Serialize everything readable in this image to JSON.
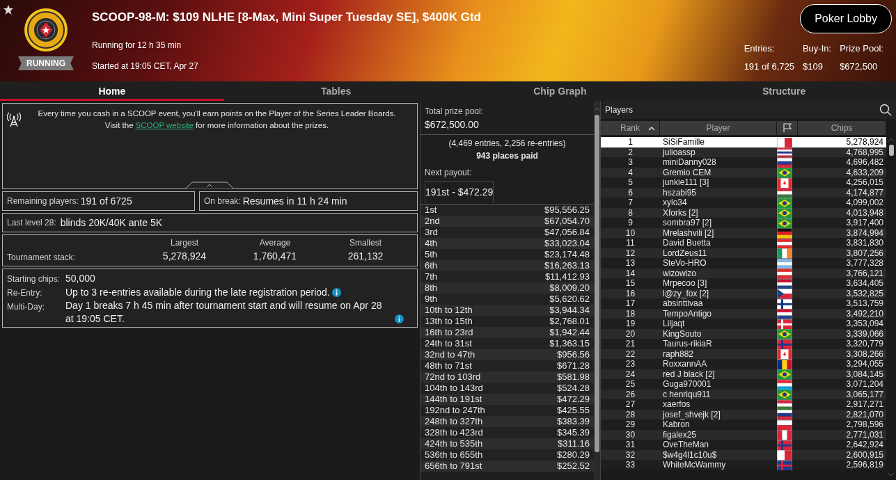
{
  "header": {
    "status": "RUNNING",
    "title": "SCOOP-98-M: $109 NLHE [8-Max, Mini Super Tuesday SE], $400K Gtd",
    "running_for": "Running for 12 h 35 min",
    "started": "Started at 19:05 CET, Apr 27",
    "button": "Poker Lobby",
    "stats": [
      {
        "label": "Entries:",
        "value": "191 of 6,725"
      },
      {
        "label": "Buy-In:",
        "value": "$109"
      },
      {
        "label": "Prize Pool:",
        "value": "$672,500"
      }
    ]
  },
  "tabs": [
    {
      "label": "Home",
      "selected": true
    },
    {
      "label": "Tables",
      "selected": false
    },
    {
      "label": "Chip Graph",
      "selected": false
    },
    {
      "label": "Structure",
      "selected": false
    }
  ],
  "notice": {
    "line1": "Every time you cash in a SCOOP event, you'll earn points on the Player of the Series Leader Boards.",
    "before_link": "Visit the",
    "link": "SCOOP website",
    "after_link": "for more information about the prizes."
  },
  "remaining": {
    "label": "Remaining players:",
    "value": "191 of 6725"
  },
  "on_break": {
    "label": "On break:",
    "value": "Resumes in 11 h 24 min"
  },
  "last_level": {
    "label": "Last level 28:",
    "value": "blinds 20K/40K ante 5K"
  },
  "stack": {
    "label": "Tournament stack:",
    "columns": [
      {
        "label": "Largest",
        "value": "5,278,924"
      },
      {
        "label": "Average",
        "value": "1,760,471"
      },
      {
        "label": "Smallest",
        "value": "261,132"
      }
    ]
  },
  "details": [
    {
      "label": "Starting chips:",
      "value": "50,000",
      "info": false
    },
    {
      "label": "Re-Entry:",
      "value": "Up to 3 re-entries available during the late registration period.",
      "info": true
    },
    {
      "label": "Multi-Day:",
      "value": "Day 1 breaks 7 h 45 min after tournament start and will resume on Apr 28 at 19:05 CET.",
      "info": true
    }
  ],
  "prize": {
    "label": "Total prize pool:",
    "value": "$672,500.00",
    "entries": "(4,469 entries, 2,256 re-entries)",
    "places": "943 places paid",
    "next_label": "Next payout:",
    "next_value": "191st - $472.29"
  },
  "payouts": [
    {
      "place": "1st",
      "amount": "$95,556.25"
    },
    {
      "place": "2nd",
      "amount": "$67,054.70"
    },
    {
      "place": "3rd",
      "amount": "$47,056.84"
    },
    {
      "place": "4th",
      "amount": "$33,023.04"
    },
    {
      "place": "5th",
      "amount": "$23,174.48"
    },
    {
      "place": "6th",
      "amount": "$16,263.13"
    },
    {
      "place": "7th",
      "amount": "$11,412.93"
    },
    {
      "place": "8th",
      "amount": "$8,009.20"
    },
    {
      "place": "9th",
      "amount": "$5,620.62"
    },
    {
      "place": "10th to 12th",
      "amount": "$3,944.34"
    },
    {
      "place": "13th to 15th",
      "amount": "$2,768.01"
    },
    {
      "place": "16th to 23rd",
      "amount": "$1,942.44"
    },
    {
      "place": "24th to 31st",
      "amount": "$1,363.15"
    },
    {
      "place": "32nd to 47th",
      "amount": "$956.56"
    },
    {
      "place": "48th to 71st",
      "amount": "$671.28"
    },
    {
      "place": "72nd to 103rd",
      "amount": "$581.98"
    },
    {
      "place": "104th to 143rd",
      "amount": "$524.28"
    },
    {
      "place": "144th to 191st",
      "amount": "$472.29"
    },
    {
      "place": "192nd to 247th",
      "amount": "$425.55"
    },
    {
      "place": "248th to 327th",
      "amount": "$383.39"
    },
    {
      "place": "328th to 423rd",
      "amount": "$345.39"
    },
    {
      "place": "424th to 535th",
      "amount": "$311.16"
    },
    {
      "place": "536th to 655th",
      "amount": "$280.29"
    },
    {
      "place": "656th to 791st",
      "amount": "$252.52"
    }
  ],
  "players": {
    "title": "Players",
    "columns": [
      "Rank",
      "Player",
      "Chips"
    ],
    "rows": [
      {
        "rank": "1",
        "name": "SiSiFamille",
        "chips": "5,278,924",
        "selected": true
      },
      {
        "rank": "2",
        "name": "julioassp",
        "chips": "4,768,995",
        "selected": false
      },
      {
        "rank": "3",
        "name": "miniDanny028",
        "chips": "4,696,482",
        "selected": false
      },
      {
        "rank": "4",
        "name": "Gremio CEM",
        "chips": "4,633,209",
        "selected": false
      },
      {
        "rank": "5",
        "name": "junkie111 [3]",
        "chips": "4,256,015",
        "selected": false
      },
      {
        "rank": "6",
        "name": "hszabi95",
        "chips": "4,174,877",
        "selected": false
      },
      {
        "rank": "7",
        "name": "xylo34",
        "chips": "4,099,002",
        "selected": false
      },
      {
        "rank": "8",
        "name": "Xforks [2]",
        "chips": "4,013,948",
        "selected": false
      },
      {
        "rank": "9",
        "name": "sombra97 [2]",
        "chips": "3,917,400",
        "selected": false
      },
      {
        "rank": "10",
        "name": "Mrelashvili [2]",
        "chips": "3,874,994",
        "selected": false
      },
      {
        "rank": "11",
        "name": "David Buetta",
        "chips": "3,831,830",
        "selected": false
      },
      {
        "rank": "12",
        "name": "LordZeus11",
        "chips": "3,807,256",
        "selected": false
      },
      {
        "rank": "13",
        "name": "SteVo-HRO",
        "chips": "3,777,328",
        "selected": false
      },
      {
        "rank": "14",
        "name": "wizowizo",
        "chips": "3,766,121",
        "selected": false
      },
      {
        "rank": "15",
        "name": "Mrpecoo [3]",
        "chips": "3,634,405",
        "selected": false
      },
      {
        "rank": "16",
        "name": "l@zy_fox [2]",
        "chips": "3,532,825",
        "selected": false
      },
      {
        "rank": "17",
        "name": "absinttivaa",
        "chips": "3,513,759",
        "selected": false
      },
      {
        "rank": "18",
        "name": "TempoAntigo",
        "chips": "3,492,210",
        "selected": false
      },
      {
        "rank": "19",
        "name": "Liljaqt",
        "chips": "3,353,094",
        "selected": false
      },
      {
        "rank": "20",
        "name": "KingSouto",
        "chips": "3,339,066",
        "selected": false
      },
      {
        "rank": "21",
        "name": "Taurus-rikiaR",
        "chips": "3,320,779",
        "selected": false
      },
      {
        "rank": "22",
        "name": "raph882",
        "chips": "3,308,266",
        "selected": false
      },
      {
        "rank": "23",
        "name": "RoxxannAA",
        "chips": "3,294,055",
        "selected": false
      },
      {
        "rank": "24",
        "name": "red J black [2]",
        "chips": "3,084,145",
        "selected": false
      },
      {
        "rank": "25",
        "name": "Guga970001",
        "chips": "3,071,204",
        "selected": false
      },
      {
        "rank": "26",
        "name": "c henriqu911",
        "chips": "3,065,177",
        "selected": false
      },
      {
        "rank": "27",
        "name": "xaerfos",
        "chips": "2,917,271",
        "selected": false
      },
      {
        "rank": "28",
        "name": "josef_shvejk [2]",
        "chips": "2,821,070",
        "selected": false
      },
      {
        "rank": "29",
        "name": "Kabron",
        "chips": "2,798,596",
        "selected": false
      },
      {
        "rank": "30",
        "name": "figalex25",
        "chips": "2,771,031",
        "selected": false
      },
      {
        "rank": "31",
        "name": "OveTheMan",
        "chips": "2,642,924",
        "selected": false
      },
      {
        "rank": "32",
        "name": "$w4g4l1c10u$",
        "chips": "2,600,915",
        "selected": false
      },
      {
        "rank": "33",
        "name": "WhiteMcWammy",
        "chips": "2,596,819",
        "selected": false
      }
    ]
  }
}
